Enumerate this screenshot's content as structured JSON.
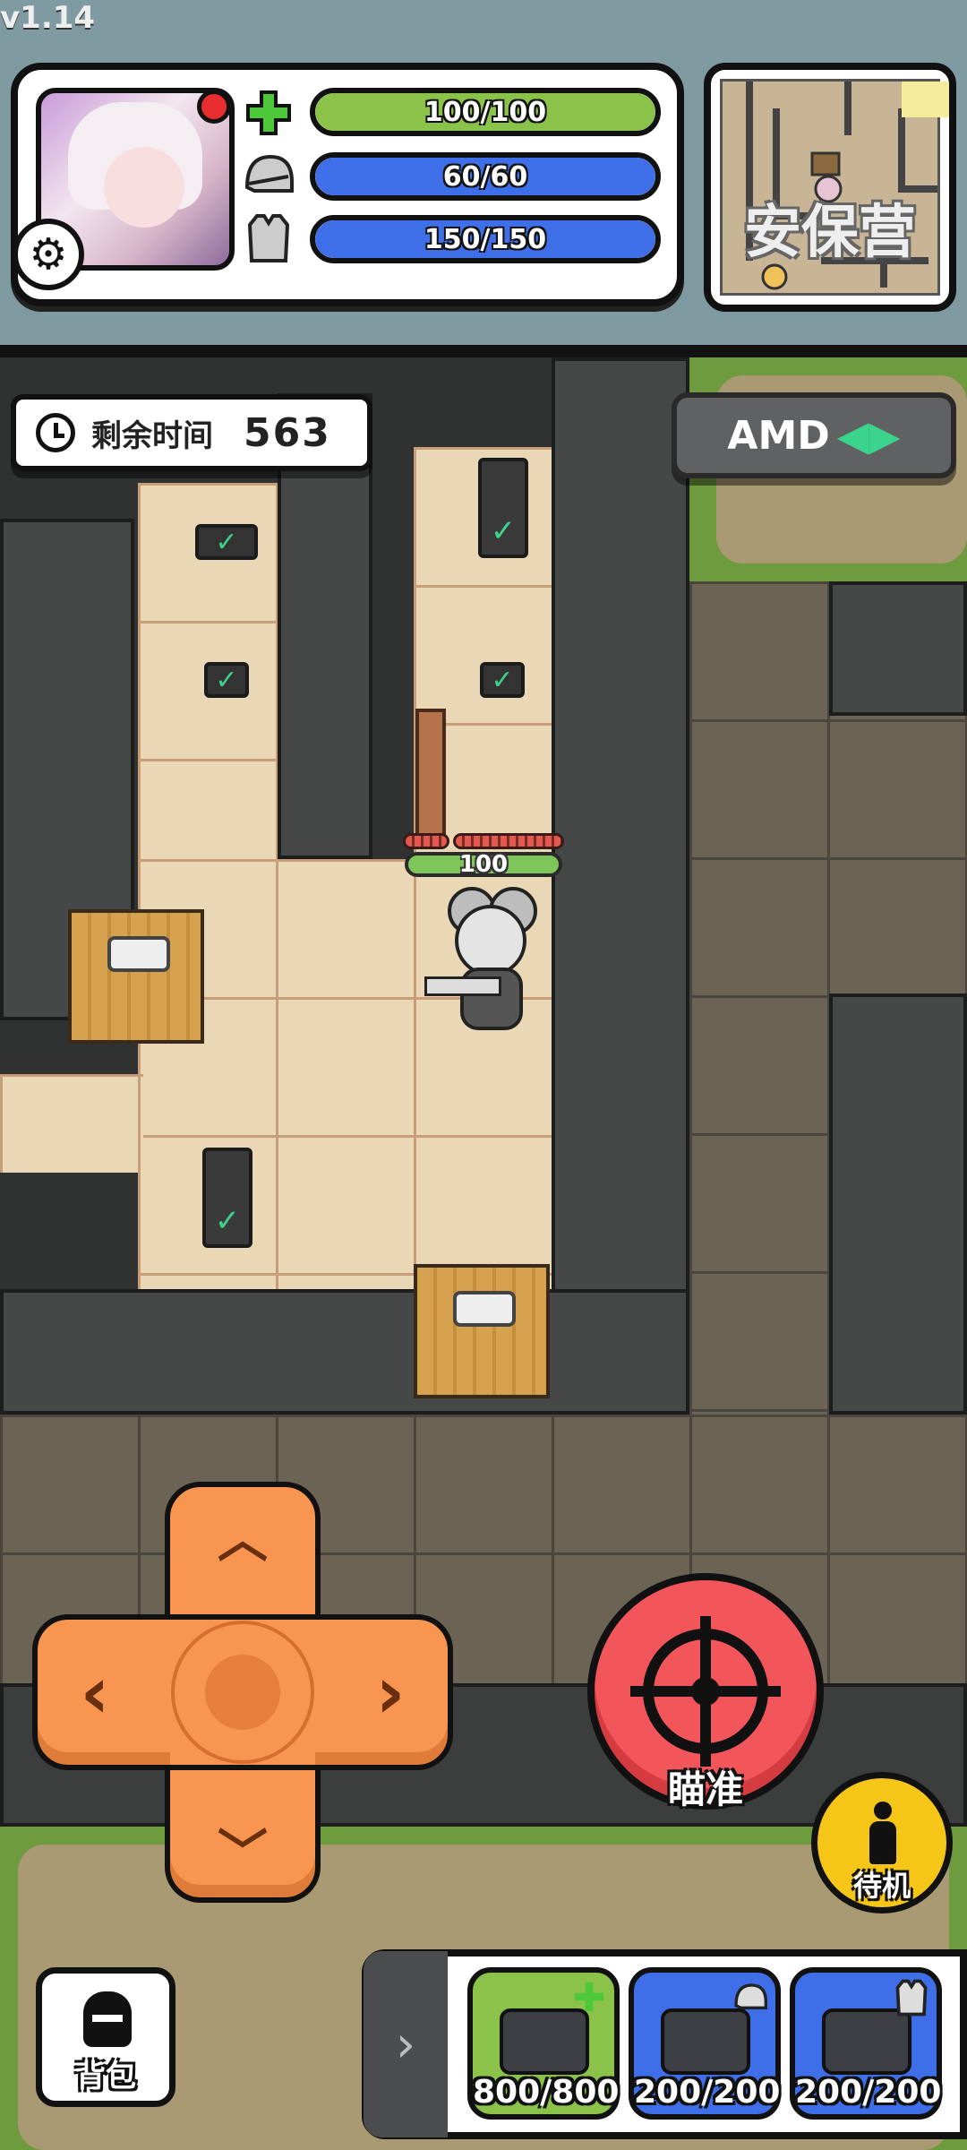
{
  "version": "v1.14",
  "status": {
    "health": {
      "label": "100/100",
      "value": 100,
      "max": 100,
      "color": "#8bc34a",
      "icon": "plus-icon"
    },
    "helmet": {
      "label": "60/60",
      "value": 60,
      "max": 60,
      "color": "#3f6fe8",
      "icon": "helmet-icon"
    },
    "armor": {
      "label": "150/150",
      "value": 150,
      "max": 150,
      "color": "#3f6fe8",
      "icon": "vest-icon"
    }
  },
  "minimap": {
    "location_label": "安保营"
  },
  "timer": {
    "label": "剩余时间",
    "value": "563"
  },
  "amd_button": {
    "label": "AMD"
  },
  "player": {
    "hp_label": "100",
    "hp": 100
  },
  "controls": {
    "dpad": {
      "up": "︿",
      "down": "﹀",
      "left": "‹",
      "right": "›"
    },
    "aim_label": "瞄准",
    "standby_label": "待机",
    "backpack_label": "背包"
  },
  "quickbar": {
    "toggle": "›",
    "slots": [
      {
        "label": "800/800",
        "type": "medkit",
        "color": "#8bc34a"
      },
      {
        "label": "200/200",
        "type": "helmet-repair",
        "color": "#3f6fe8"
      },
      {
        "label": "200/200",
        "type": "armor-repair",
        "color": "#3f6fe8"
      }
    ]
  },
  "colors": {
    "health": "#8bc34a",
    "shield": "#3f6fe8",
    "aim": "#f2555a",
    "dpad": "#f79551",
    "standby": "#f5c518"
  }
}
